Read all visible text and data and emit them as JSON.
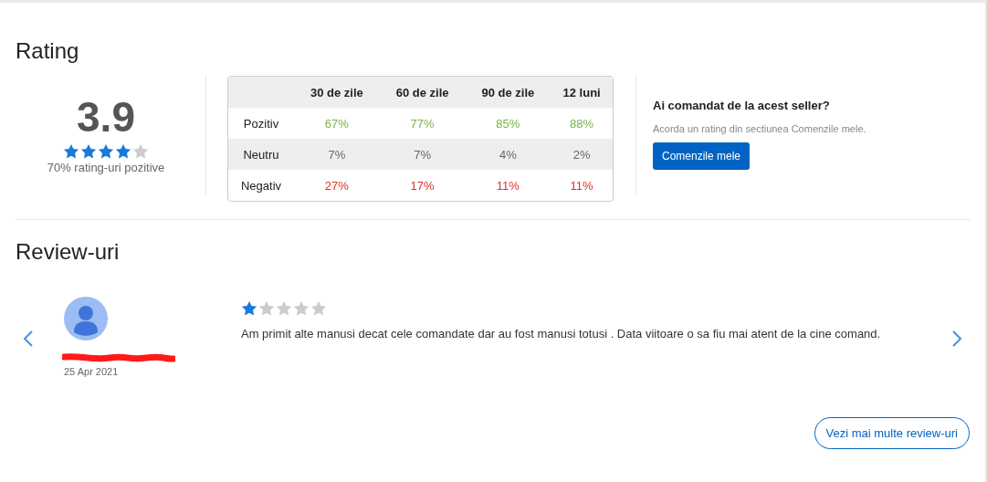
{
  "rating": {
    "title": "Rating",
    "score": "3.9",
    "stars": 4,
    "positive_label": "70% rating-uri pozitive"
  },
  "table": {
    "columns": [
      "30 de zile",
      "60 de zile",
      "90 de zile",
      "12 luni"
    ],
    "rows": [
      {
        "label": "Pozitiv",
        "kind": "positive",
        "values": [
          "67%",
          "77%",
          "85%",
          "88%"
        ]
      },
      {
        "label": "Neutru",
        "kind": "neutral",
        "values": [
          "7%",
          "7%",
          "4%",
          "2%"
        ]
      },
      {
        "label": "Negativ",
        "kind": "negative",
        "values": [
          "27%",
          "17%",
          "11%",
          "11%"
        ]
      }
    ]
  },
  "cta": {
    "heading": "Ai comandat de la acest seller?",
    "text": "Acorda un rating din sectiunea Comenzile mele.",
    "button": "Comenzile mele"
  },
  "reviews": {
    "title": "Review-uri",
    "items": [
      {
        "name_redacted": true,
        "date": "25 Apr 2021",
        "stars": 1,
        "text": "Am primit alte manusi decat cele comandate dar au fost manusi totusi . Data viitoare o sa fiu mai atent de la cine comand."
      }
    ],
    "more_button": "Vezi mai multe review-uri"
  }
}
